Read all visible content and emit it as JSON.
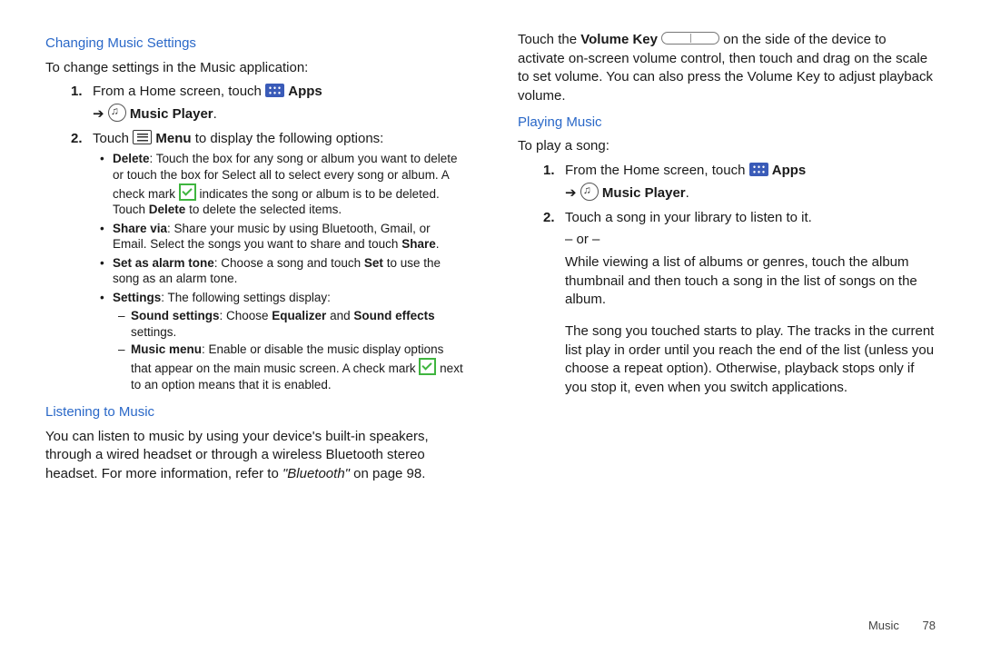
{
  "left": {
    "h1": "Changing Music Settings",
    "intro": "To change settings in the Music application:",
    "s1_num": "1.",
    "s1_a": "From a Home screen, touch ",
    "apps": "Apps",
    "arrow": "➔",
    "music_player": "Music Player",
    "period": ".",
    "s2_num": "2.",
    "s2_a": "Touch ",
    "s2_b": "Menu",
    "s2_c": " to display the following options:",
    "b1_t": "Delete",
    "b1_a": ": Touch the box for any song or album you want to delete or touch the box for Select all to select every song or album. A check mark ",
    "b1_b": " indicates the song or album is to be deleted. Touch ",
    "b1_c": " to delete the selected items.",
    "b2_t": "Share via",
    "b2_a": ": Share your music by using Bluetooth, Gmail, or Email. Select the songs you want to share and touch ",
    "share": "Share",
    "b3_t": "Set as alarm tone",
    "b3_a": ": Choose a song and touch ",
    "set": "Set",
    "b3_b": " to use the song as an alarm tone.",
    "b4_t": "Settings",
    "b4_a": ": The following settings display:",
    "d1_t": "Sound settings",
    "d1_a": ": Choose ",
    "eq": "Equalizer",
    "d1_b": " and ",
    "se": "Sound effects",
    "d1_c": " settings.",
    "d2_t": "Music menu",
    "d2_a": ": Enable or disable the music display options that appear on the main music screen. A check mark ",
    "d2_b": " next to an option means that it is enabled.",
    "h2": "Listening to Music",
    "l_a": "You can listen to music by using your device's built-in speakers, through a wired headset or through a wireless Bluetooth stereo headset. For more information, refer to ",
    "l_ref": "\"Bluetooth\"",
    "l_b": " on page 98."
  },
  "right": {
    "top_a": "Touch the ",
    "vk": "Volume Key",
    "top_b": " on the side of the device to activate on-screen volume control, then touch and drag on the scale to set volume. You can also press the Volume Key to adjust playback volume.",
    "h3": "Playing Music",
    "intro": "To play a song:",
    "s1_num": "1.",
    "s1_a": "From the Home screen, touch ",
    "s2_num": "2.",
    "s2_a": "Touch a song in your library to listen to it.",
    "or": "– or –",
    "s2_b": "While viewing a list of albums or genres, touch the album thumbnail and then touch a song in the list of songs on the album.",
    "p3": "The song you touched starts to play. The tracks in the current list play in order until you reach the end of the list (unless you choose a repeat option). Otherwise, playback stops only if you stop it, even when you switch applications."
  },
  "footer_section": "Music",
  "footer_page": "78"
}
